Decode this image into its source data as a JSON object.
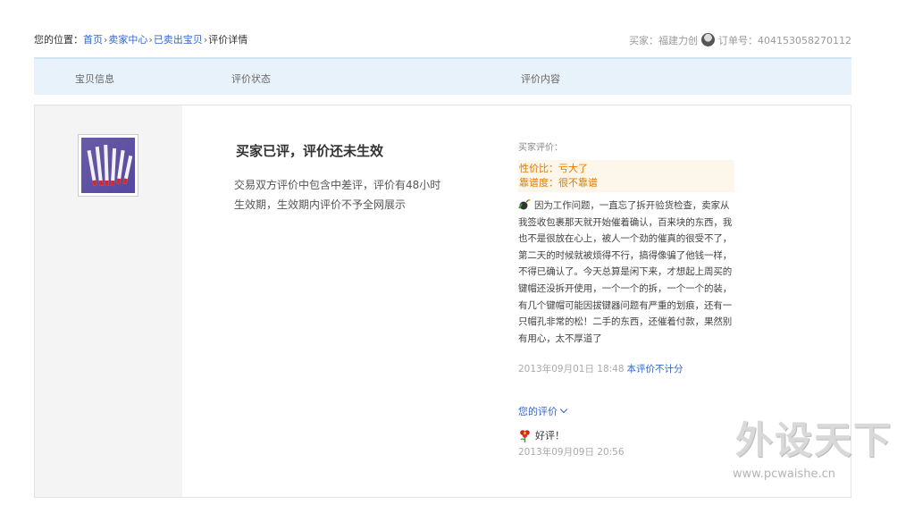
{
  "breadcrumb": {
    "prefix": "您的位置：",
    "links": [
      "首页",
      "卖家中心",
      "已卖出宝贝"
    ],
    "separator": "›",
    "current": "评价详情"
  },
  "order": {
    "buyer_label": "买家：",
    "buyer_name": "福建力创",
    "order_label": "订单号：",
    "order_number": "404153058270112"
  },
  "table_header": {
    "col1": "宝贝信息",
    "col2": "评价状态",
    "col3": "评价内容"
  },
  "status": {
    "title": "买家已评，评价还未生效",
    "description": "交易双方评价中包含中差评，评价有48小时生效期，生效期内评价不予全网展示"
  },
  "evaluation": {
    "buyer_label": "买家评价：",
    "ratings": [
      "性价比：亏大了",
      "靠谱度：很不靠谱"
    ],
    "comment": "因为工作问题，一直忘了拆开验货检查，卖家从我签收包裹那天就开始催着确认，百来块的东西，我也不是很放在心上，被人一个劲的催真的很受不了，第二天的时候就被烦得不行，搞得像骗了他钱一样，不得已确认了。今天总算是闲下来，才想起上周买的键帽还没拆开使用，一个一个的拆，一个一个的装，有几个键帽可能因拔键器问题有严重的划痕，还有一只帽孔非常的松！二手的东西，还催着付款，果然别有用心，太不厚道了",
    "time": "2013年09月01日 18:48",
    "note": "本评价不计分",
    "your_eval_label": "您的评价",
    "reply": "好评！",
    "reply_time": "2013年09月09日 20:56"
  },
  "watermark": {
    "text": "外设天下",
    "url": "www.pcwaishe.cn"
  },
  "colors": {
    "link": "#3366cc",
    "rating": "#e07b00",
    "header_bg": "#e8f2fa",
    "left_col_bg": "#f4f4f4"
  },
  "icons": [
    "avatar-icon",
    "bomb-icon",
    "flower-icon",
    "chevron-down-icon"
  ]
}
